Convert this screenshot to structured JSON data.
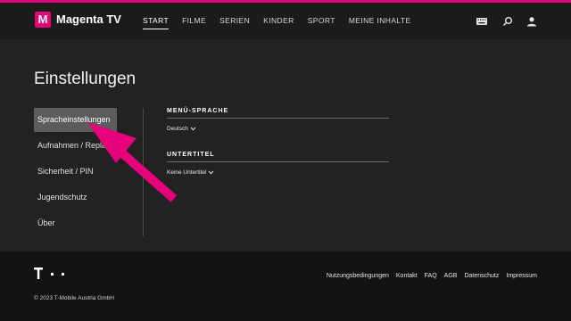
{
  "header": {
    "logo_letter": "M",
    "brand": "Magenta TV",
    "nav": [
      {
        "label": "START",
        "active": true
      },
      {
        "label": "FILME",
        "active": false
      },
      {
        "label": "SERIEN",
        "active": false
      },
      {
        "label": "KINDER",
        "active": false
      },
      {
        "label": "SPORT",
        "active": false
      },
      {
        "label": "MEINE INHALTE",
        "active": false
      }
    ],
    "icons": [
      "keyboard-icon",
      "search-icon",
      "user-icon"
    ]
  },
  "page": {
    "title": "Einstellungen"
  },
  "sidebar": {
    "items": [
      {
        "label": "Spracheinstellungen",
        "active": true
      },
      {
        "label": "Aufnahmen / Replay",
        "active": false
      },
      {
        "label": "Sicherheit / PIN",
        "active": false
      },
      {
        "label": "Jugendschutz",
        "active": false
      },
      {
        "label": "Über",
        "active": false
      }
    ]
  },
  "settings": {
    "menu_language": {
      "title": "MENÜ-SPRACHE",
      "value": "Deutsch"
    },
    "subtitles": {
      "title": "UNTERTITEL",
      "value": "Keine Untertitel"
    }
  },
  "footer": {
    "links": [
      "Nutzungsbedingungen",
      "Kontakt",
      "FAQ",
      "AGB",
      "Datenschutz",
      "Impressum"
    ],
    "copyright": "© 2023 T-Mobile Austria GmbH"
  },
  "colors": {
    "accent": "#e20074",
    "background": "#222222",
    "header": "#1b1b1b",
    "footer": "#121212",
    "active_item": "#5c5c5c"
  }
}
